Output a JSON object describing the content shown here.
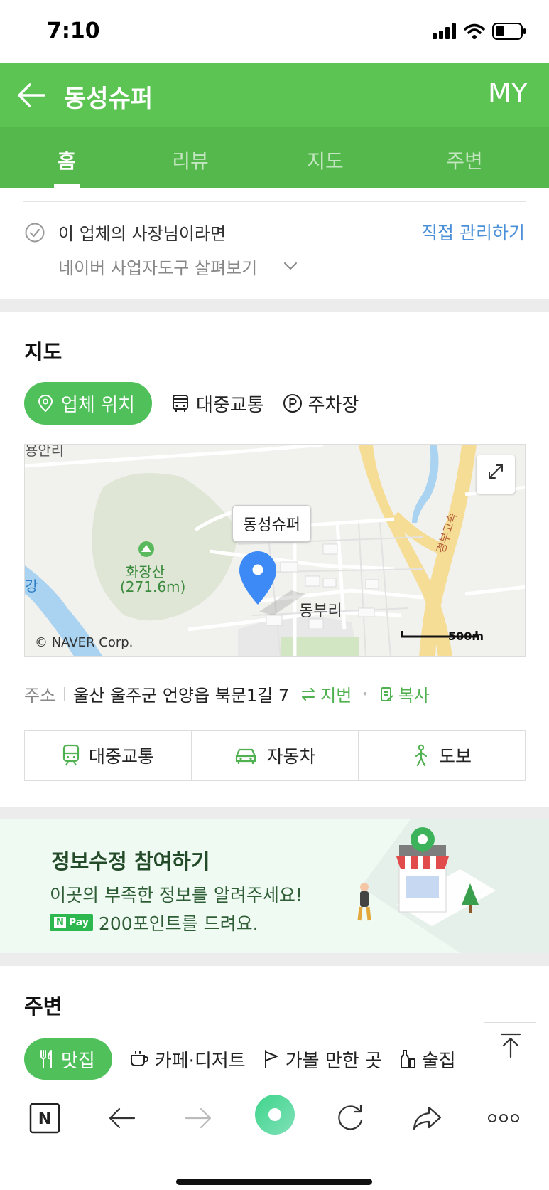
{
  "status_bar": {
    "time": "7:10"
  },
  "header": {
    "title": "동성슈퍼",
    "my_label": "MY"
  },
  "tabs": [
    {
      "label": "홈",
      "active": true
    },
    {
      "label": "리뷰",
      "active": false
    },
    {
      "label": "지도",
      "active": false
    },
    {
      "label": "주변",
      "active": false
    }
  ],
  "owner": {
    "text": "이 업체의 사장님이라면",
    "link": "직접 관리하기",
    "sub": "네이버 사업자도구 살펴보기"
  },
  "map_section": {
    "title": "지도",
    "tabs": [
      {
        "label": "업체 위치",
        "icon": "location-pin-icon",
        "active": true
      },
      {
        "label": "대중교통",
        "icon": "bus-icon",
        "active": false
      },
      {
        "label": "주차장",
        "icon": "parking-icon",
        "active": false
      }
    ],
    "map": {
      "callout": "동성슈퍼",
      "mountain_name": "화장산",
      "mountain_height": "(271.6m)",
      "district": "동부리",
      "river": "강",
      "highway": "경부고속",
      "top_label": "용안리",
      "copyright": "© NAVER Corp.",
      "scale": "500m"
    },
    "address": {
      "label": "주소",
      "value": "울산 울주군 언양읍 북문1길 7",
      "switch_label": "지번",
      "copy_label": "복사"
    },
    "routes": [
      {
        "label": "대중교통",
        "icon": "train-icon"
      },
      {
        "label": "자동차",
        "icon": "car-icon"
      },
      {
        "label": "도보",
        "icon": "walk-icon"
      }
    ]
  },
  "banner": {
    "title": "정보수정 참여하기",
    "line1": "이곳의 부족한 정보를 알려주세요!",
    "pay_n": "N",
    "pay_label": "Pay",
    "line2": "200포인트를 드려요."
  },
  "nearby": {
    "title": "주변",
    "tabs": [
      {
        "label": "맛집",
        "icon": "fork-knife-icon",
        "active": true
      },
      {
        "label": "카페·디저트",
        "icon": "coffee-cup-icon",
        "active": false
      },
      {
        "label": "가볼 만한 곳",
        "icon": "flag-icon",
        "active": false
      },
      {
        "label": "술집",
        "icon": "bottle-icon",
        "active": false
      }
    ]
  },
  "bottom_bar": {
    "n_label": "N"
  },
  "colors": {
    "brand_green": "#5cc453",
    "tab_green": "#55b84c",
    "link_blue": "#4a90d9",
    "action_green": "#4fb14f"
  }
}
